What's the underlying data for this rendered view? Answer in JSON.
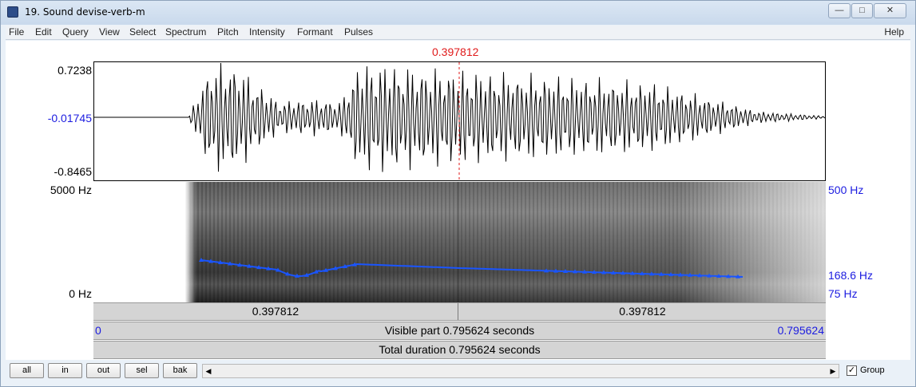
{
  "window": {
    "title": "19. Sound devise-verb-m",
    "controls": {
      "minimize": "—",
      "maximize": "□",
      "close": "✕"
    }
  },
  "menu": {
    "items": [
      "File",
      "Edit",
      "Query",
      "View",
      "Select",
      "Spectrum",
      "Pitch",
      "Intensity",
      "Formant",
      "Pulses"
    ],
    "help": "Help"
  },
  "cursor": {
    "time": "0.397812",
    "color": "#e01a1a"
  },
  "waveform": {
    "max_label": "0.7238",
    "cursor_value_label": "-0.01745",
    "min_label": "-0.8465"
  },
  "spectrogram": {
    "top_freq_label": "5000 Hz",
    "bottom_freq_label": "0 Hz",
    "pitch_top_label": "500 Hz",
    "pitch_value_label": "168.6 Hz",
    "pitch_bottom_label": "75 Hz",
    "pitch_color": "#1a55ff"
  },
  "time_bars": {
    "left_segment": "0.397812",
    "right_segment": "0.397812",
    "visible_start": "0",
    "visible_text": "Visible part 0.795624 seconds",
    "visible_end": "0.795624",
    "total_text": "Total duration 0.795624 seconds"
  },
  "toolbar": {
    "buttons": [
      "all",
      "in",
      "out",
      "sel",
      "bak"
    ],
    "scroll_left": "◀",
    "scroll_right": "▶",
    "group_label": "Group",
    "group_checked": "✓"
  },
  "colors": {
    "label_blue": "#1c1ce0",
    "cursor_red": "#e01a1a"
  }
}
